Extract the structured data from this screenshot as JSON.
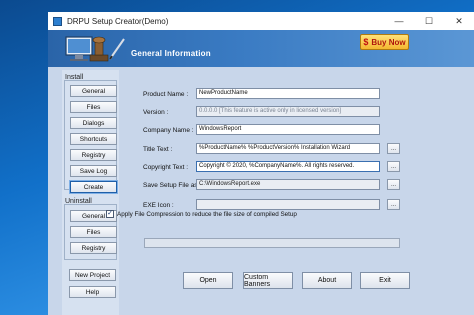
{
  "window": {
    "title": "DRPU Setup Creator(Demo)",
    "minimize_glyph": "—",
    "maximize_glyph": "☐",
    "close_glyph": "✕"
  },
  "banner": {
    "title": "General Information",
    "buy_now_icon": "$",
    "buy_now_label": "Buy Now"
  },
  "install": {
    "label": "Install",
    "buttons": [
      "General",
      "Files",
      "Dialogs",
      "Shortcuts",
      "Registry",
      "Save Log",
      "Create"
    ]
  },
  "uninstall": {
    "label": "Uninstall",
    "buttons": [
      "General",
      "Files",
      "Registry"
    ]
  },
  "left_bottom": {
    "new_project": "New Project",
    "help": "Help"
  },
  "form": {
    "product_name": {
      "label": "Product Name :",
      "value": "NewProductName"
    },
    "version": {
      "label": "Version :",
      "value": "0.0.0.0 [This feature is active only in licensed version]"
    },
    "company_name": {
      "label": "Company Name :",
      "value": "WindowsReport"
    },
    "title_text": {
      "label": "Title Text :",
      "value": "%ProductName% %ProductVersion% Installation Wizard"
    },
    "copyright_text": {
      "label": "Copyright Text :",
      "value": "Copyright © 2020, %CompanyName%. All rights reserved."
    },
    "save_setup_file_as": {
      "label": "Save Setup File as :",
      "value": "C:\\WindowsReport.exe"
    },
    "exe_icon": {
      "label": "EXE Icon :",
      "value": ""
    },
    "browse_label": "...",
    "compression": {
      "checked": true,
      "label": "Apply File Compression to reduce the file size of compiled Setup",
      "check_glyph": "✓"
    }
  },
  "bottom_buttons": [
    "Open",
    "Custom Banners",
    "About",
    "Exit"
  ],
  "colors": {
    "banner": "#2a64a8",
    "client_bg": "#c8d6ea",
    "buy_now": "#f4b62f"
  }
}
